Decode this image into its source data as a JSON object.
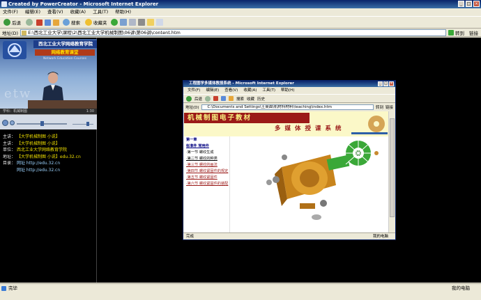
{
  "window": {
    "title": "Created by PowerCreator - Microsoft Internet Explorer"
  },
  "menubar": [
    "文件(F)",
    "编辑(E)",
    "查看(V)",
    "收藏(A)",
    "工具(T)",
    "帮助(H)"
  ],
  "toolbar": {
    "back": "后退",
    "search": "搜索",
    "favorites": "收藏夹"
  },
  "address": {
    "label": "地址(D)",
    "value": "E:\\西北工业大学\\课程\\2\\西北工业大学机械制图\\06讲\\第06讲\\content.htm",
    "go": "转到",
    "links": "链接"
  },
  "video": {
    "banner_title": "西北工业大学网络教育学院",
    "banner_sub": "网络教育课堂",
    "banner_sub_en": "Network Education Courses",
    "watermark": "etw",
    "caption_left": "学科：机械制图",
    "caption_right": "1:30"
  },
  "info": [
    {
      "key": "主讲：",
      "value": "【大学机械制图 小说】",
      "link": false
    },
    {
      "key": "主讲：",
      "value": "【大学机械制图 小说】",
      "link": false
    },
    {
      "key": "单位：",
      "value": "西北工业大学网络教育学院",
      "link": false
    },
    {
      "key": "地址：",
      "value": "【大学机械制图 小说】edu.32.cn",
      "link": false
    },
    {
      "key": "目录：",
      "value": "网址  http://edu.32.cn",
      "link": true
    },
    {
      "key": "",
      "value": "网址  http://edu.32.cn",
      "link": true
    }
  ],
  "status": {
    "left": "完毕",
    "right": "我的电脑"
  },
  "inner": {
    "title": "工程图学多媒体教授系统 - Microsoft Internet Explorer",
    "menubar": [
      "文件(F)",
      "编辑(E)",
      "查看(V)",
      "收藏(A)",
      "工具(T)",
      "帮助(H)"
    ],
    "toolbar": {
      "back": "后退",
      "search": "搜索",
      "favorites": "收藏",
      "history": "历史"
    },
    "address": {
      "label": "地址(D)",
      "value": "C:\\Documents and Settings\\王桌面\\机材科材料\\teaching\\index.htm",
      "go": "转到",
      "links": "链接"
    },
    "banner_main": "机械制图电子教材",
    "banner_sub": "多媒体授课系统",
    "menu": [
      {
        "text": "第一章",
        "style": "hd"
      },
      {
        "text": "标准件 常用件",
        "style": "hd u"
      },
      {
        "text": "·第一节 螺纹生成",
        "style": ""
      },
      {
        "text": "·第二节 螺纹的种类",
        "style": "u"
      },
      {
        "text": "·第三节 螺纹的画法",
        "style": "a u"
      },
      {
        "text": "·第四节 螺纹紧固件的规定",
        "style": "a u"
      },
      {
        "text": "·第五节 螺纹紧固件",
        "style": "a u"
      },
      {
        "text": "·第六节 螺纹紧固件的装配",
        "style": "a u"
      }
    ],
    "status_left": "完成",
    "status_right": "我的电脑"
  },
  "colors": {
    "banner_red": "#9b1a18",
    "part_gold": "#d89a20",
    "gear_green": "#3aa838",
    "info_yellow": "#f0e000"
  }
}
